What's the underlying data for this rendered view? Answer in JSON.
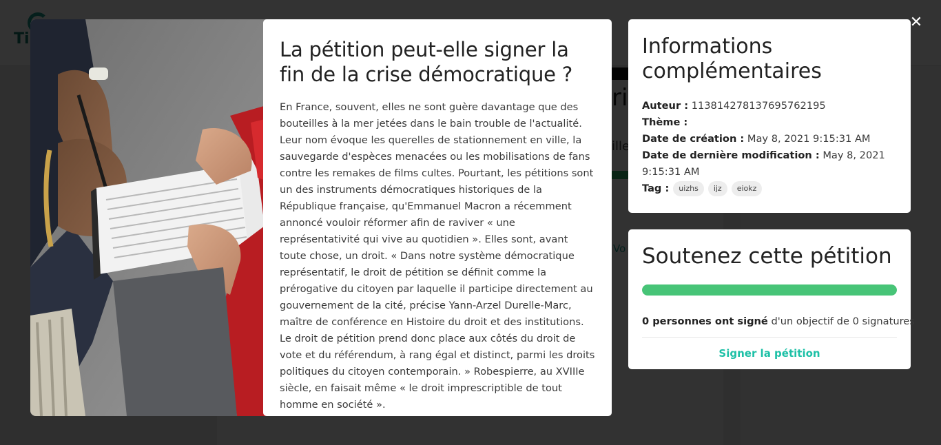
{
  "background": {
    "logo_text": "Ti",
    "heading_fragment": "ri",
    "subtitle_fragment": "ille",
    "link_fragment": "Vo"
  },
  "modal": {
    "close_label": "✕",
    "article": {
      "title": "La pétition peut-elle signer la fin de la crise démocratique ?",
      "body": "En France, souvent, elles ne sont guère davantage que des bouteilles à la mer jetées dans le bain trouble de l'actualité. Leur nom évoque les querelles de stationnement en ville, la sauvegarde d'espèces menacées ou les mobilisations de fans contre les remakes de films cultes. Pourtant, les pétitions sont un des instruments démocratiques historiques de la République française, qu'Emmanuel Macron a récemment annoncé vouloir réformer afin de raviver « une représentativité qui vive au quotidien ». Elles sont, avant toute chose, un droit. « Dans notre système démocratique représentatif, le droit de pétition se définit comme la prérogative du citoyen par laquelle il participe directement au gouvernement de la cité, précise Yann-Arzel Durelle-Marc, maître de conférence en Histoire du droit et des institutions. Le droit de pétition prend donc place aux côtés du droit de vote et du référendum, à rang égal et distinct, parmi les droits politiques du citoyen contemporain. » Robespierre, au XVIIIe siècle, en faisait même « le droit imprescriptible de tout homme en société »."
    },
    "info": {
      "title": "Informations complémentaires",
      "author_label": "Auteur :",
      "author_value": "113814278137695762195",
      "theme_label": "Thème :",
      "theme_value": "",
      "created_label": "Date de création :",
      "created_value": "May 8, 2021 9:15:31 AM",
      "modified_label": "Date de dernière modification :",
      "modified_value": "May 8, 2021 9:15:31 AM",
      "tag_label": "Tag :",
      "tags": [
        "uizhs",
        "ijz",
        "eiokz"
      ]
    },
    "support": {
      "title": "Soutenez cette pétition",
      "progress_fraction": 1.0,
      "progress_color": "#47c477",
      "signed_bold": "0 personnes ont signé",
      "signed_rest": "d'un objectif de 0 signatures",
      "sign_button": "Signer la pétition",
      "sign_color": "#1cc0a6"
    }
  }
}
